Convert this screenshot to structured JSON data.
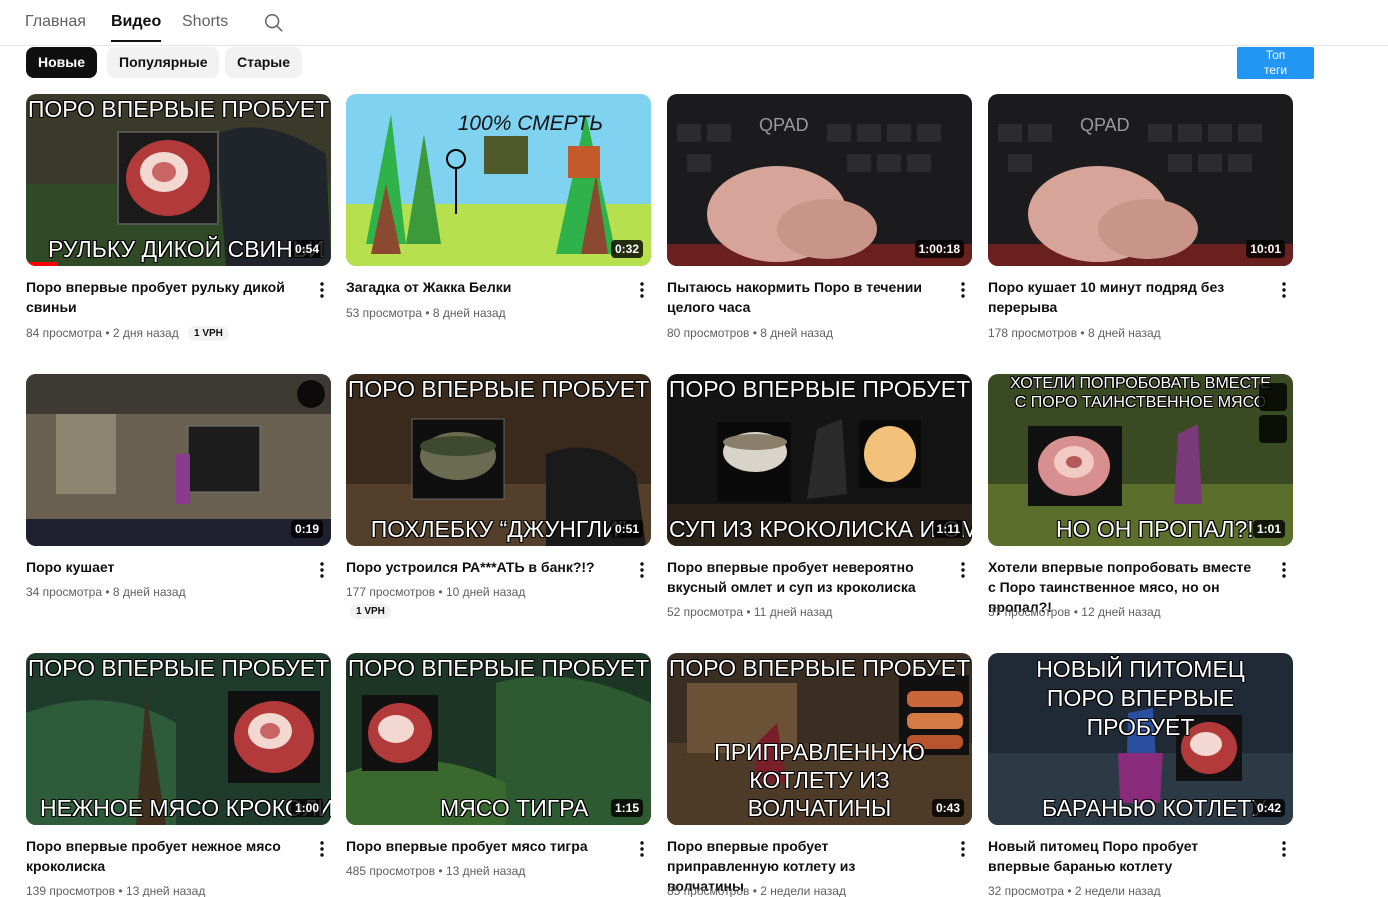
{
  "tabs": {
    "home": "Главная",
    "videos": "Видео",
    "shorts": "Shorts"
  },
  "chips": {
    "new": "Новые",
    "popular": "Популярные",
    "old": "Старые"
  },
  "top_tags": {
    "line1": "Топ",
    "line2": "теги"
  },
  "colors": {
    "accent_blue": "#2196f3",
    "progress_red": "#ff0000"
  },
  "videos": [
    {
      "title": "Поро впервые пробует рульку дикой свиньи",
      "meta": "84 просмотра • 2 дня назад",
      "badge": "1 VPH",
      "duration": "0:54",
      "cap_top": "ПОРО ВПЕРВЫЕ ПРОБУЕТ",
      "cap_bottom": "РУЛЬКУ ДИКОЙ СВИНЬИ"
    },
    {
      "title": "Загадка от Жакка Белки",
      "meta": "53 просмотра • 8 дней назад",
      "duration": "0:32",
      "cap_top": "100% СМЕРТЬ"
    },
    {
      "title": "Пытаюсь накормить Поро в течении целого часа",
      "meta": "80 просмотров • 8 дней назад",
      "duration": "1:00:18",
      "cap_top": "QPAD"
    },
    {
      "title": "Поро кушает 10 минут подряд без перерыва",
      "meta": "178 просмотров • 8 дней назад",
      "duration": "10:01",
      "cap_top": "QPAD"
    },
    {
      "title": "Поро кушает",
      "meta": "34 просмотра • 8 дней назад",
      "duration": "0:19"
    },
    {
      "title": "Поро устроился РА***АТЬ в банк?!?",
      "meta": "177 просмотров • 10 дней назад",
      "badge": "1 VPH",
      "duration": "0:51",
      "cap_top": "ПОРО ВПЕРВЫЕ ПРОБУЕТ",
      "cap_bottom": "ПОХЛЕБКУ “ДЖУНГЛИ”"
    },
    {
      "title": "Поро впервые пробует невероятно вкусный омлет и суп из кроколиска",
      "meta": "52 просмотра • 11 дней назад",
      "duration": "1:11",
      "cap_top": "ПОРО ВПЕРВЫЕ ПРОБУЕТ",
      "cap_bottom": "СУП ИЗ КРОКОЛИСКА И ОМЛЕТ"
    },
    {
      "title": "Хотели впервые попробовать вместе с Поро таинственное мясо, но он пропал?!",
      "meta": "37 просмотров • 12 дней назад",
      "duration": "1:01",
      "cap_top": "ХОТЕЛИ ПОПРОБОВАТЬ ВМЕСТЕ С ПОРО ТАИНСТВЕННОЕ МЯСО",
      "cap_bottom": "НО ОН ПРОПАЛ?!"
    },
    {
      "title": "Поро впервые пробует нежное мясо кроколиска",
      "meta": "139 просмотров • 13 дней назад",
      "duration": "1:00",
      "cap_top": "ПОРО ВПЕРВЫЕ ПРОБУЕТ",
      "cap_bottom": "НЕЖНОЕ МЯСО КРОКОЛИСКА"
    },
    {
      "title": "Поро впервые пробует мясо тигра",
      "meta": "485 просмотров • 13 дней назад",
      "duration": "1:15",
      "cap_top": "ПОРО ВПЕРВЫЕ ПРОБУЕТ",
      "cap_bottom": "МЯСО ТИГРА"
    },
    {
      "title": "Поро впервые пробует приправленную котлету из волчатины",
      "meta": "85 просмотров • 2 недели назад",
      "duration": "0:43",
      "cap_top": "ПОРО ВПЕРВЫЕ ПРОБУЕТ",
      "cap_bottom": "ПРИПРАВЛЕННУЮ КОТЛЕТУ ИЗ ВОЛЧАТИНЫ"
    },
    {
      "title": "Новый питомец Поро пробует впервые баранью котлету",
      "meta": "32 просмотра • 2 недели назад",
      "duration": "0:42",
      "cap_top": "НОВЫЙ ПИТОМЕЦ ПОРО ВПЕРВЫЕ ПРОБУЕТ",
      "cap_bottom": "БАРАНЬЮ КОТЛЕТУ"
    }
  ]
}
